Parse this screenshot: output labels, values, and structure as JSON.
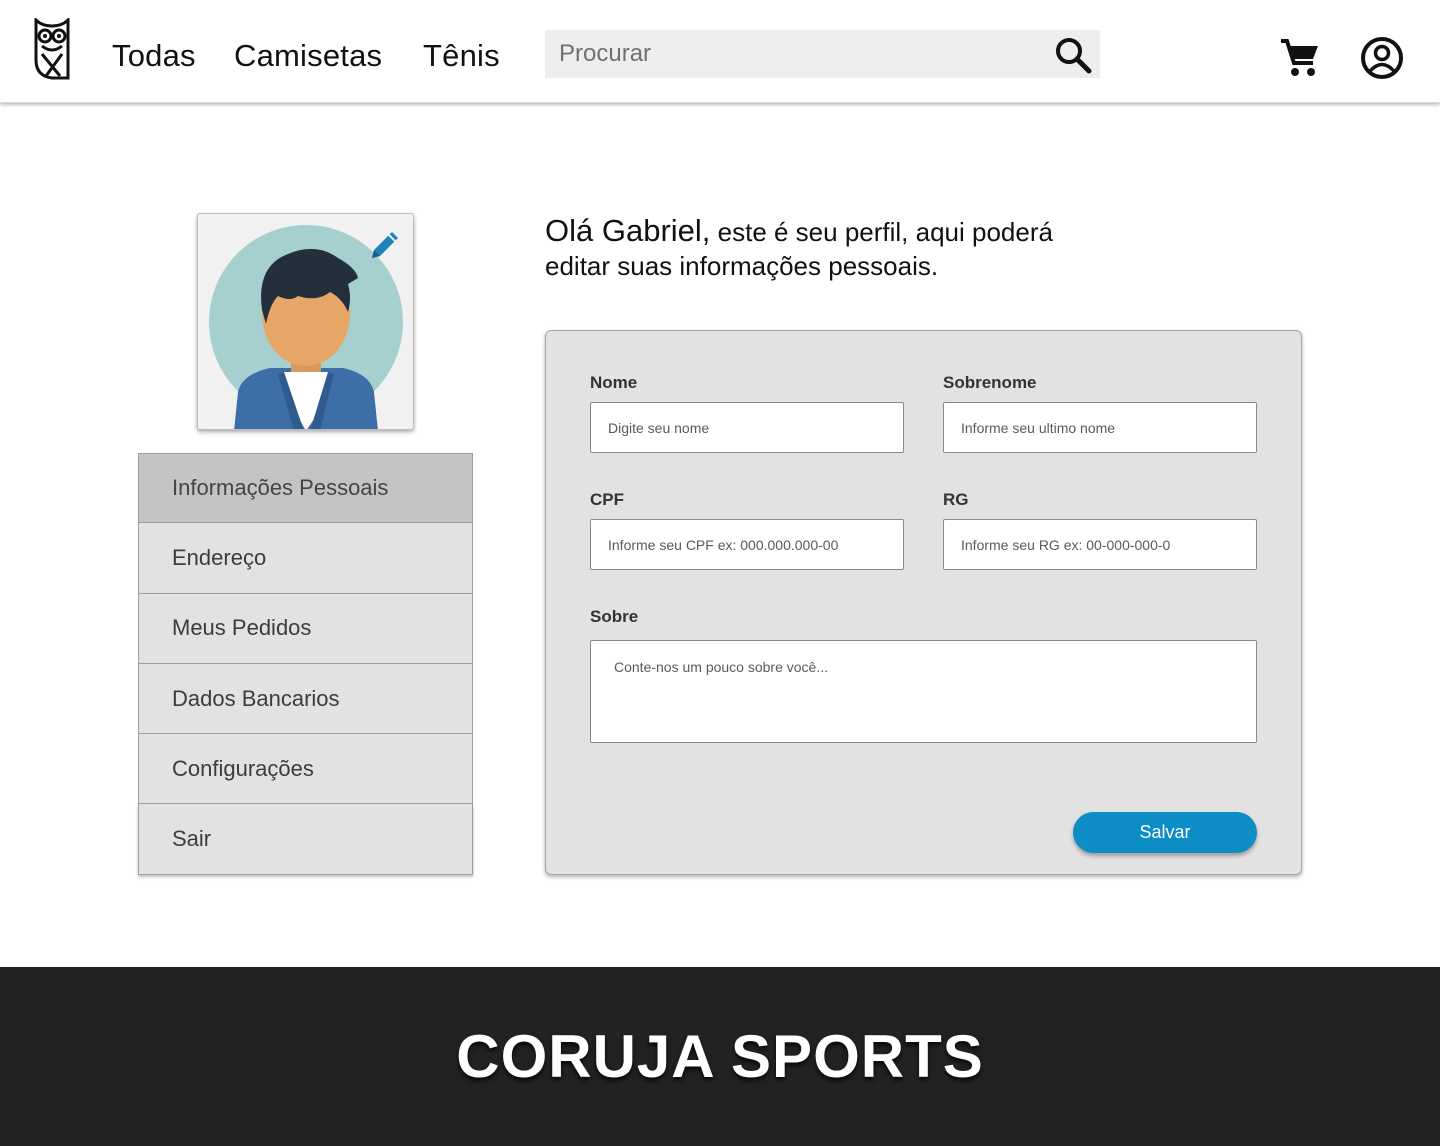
{
  "header": {
    "nav": [
      {
        "label": "Todas"
      },
      {
        "label": "Camisetas"
      },
      {
        "label": "Tênis"
      }
    ],
    "search": {
      "placeholder": "Procurar",
      "icon": "search-icon"
    },
    "cart_icon": "cart-icon",
    "account_icon": "account-circle-icon",
    "logo_icon": "owl-logo-icon"
  },
  "profile": {
    "edit_icon": "pencil-icon",
    "greeting_name": "Olá Gabriel,",
    "greeting_text": " este é seu perfil, aqui poderá editar suas informações pessoais."
  },
  "menu": {
    "items": [
      {
        "label": "Informações Pessoais",
        "active": true
      },
      {
        "label": "Endereço"
      },
      {
        "label": "Meus Pedidos"
      },
      {
        "label": "Dados Bancarios"
      },
      {
        "label": "Configurações"
      },
      {
        "label": "Sair"
      }
    ]
  },
  "form": {
    "nome": {
      "label": "Nome",
      "placeholder": "Digite seu nome",
      "value": ""
    },
    "sobrenome": {
      "label": "Sobrenome",
      "placeholder": "Informe seu ultimo nome",
      "value": ""
    },
    "cpf": {
      "label": "CPF",
      "placeholder": "Informe seu CPF ex: 000.000.000-00",
      "value": ""
    },
    "rg": {
      "label": "RG",
      "placeholder": "Informe seu RG ex: 00-000-000-0",
      "value": ""
    },
    "sobre": {
      "label": "Sobre",
      "placeholder": "Conte-nos um pouco sobre você...",
      "value": ""
    },
    "save_label": "Salvar"
  },
  "footer": {
    "brand": "CORUJA SPORTS"
  },
  "colors": {
    "accent": "#0d8dc6",
    "footer_bg": "#222222",
    "panel_bg": "#e2e2e2",
    "menu_active_bg": "#c4c4c4"
  }
}
